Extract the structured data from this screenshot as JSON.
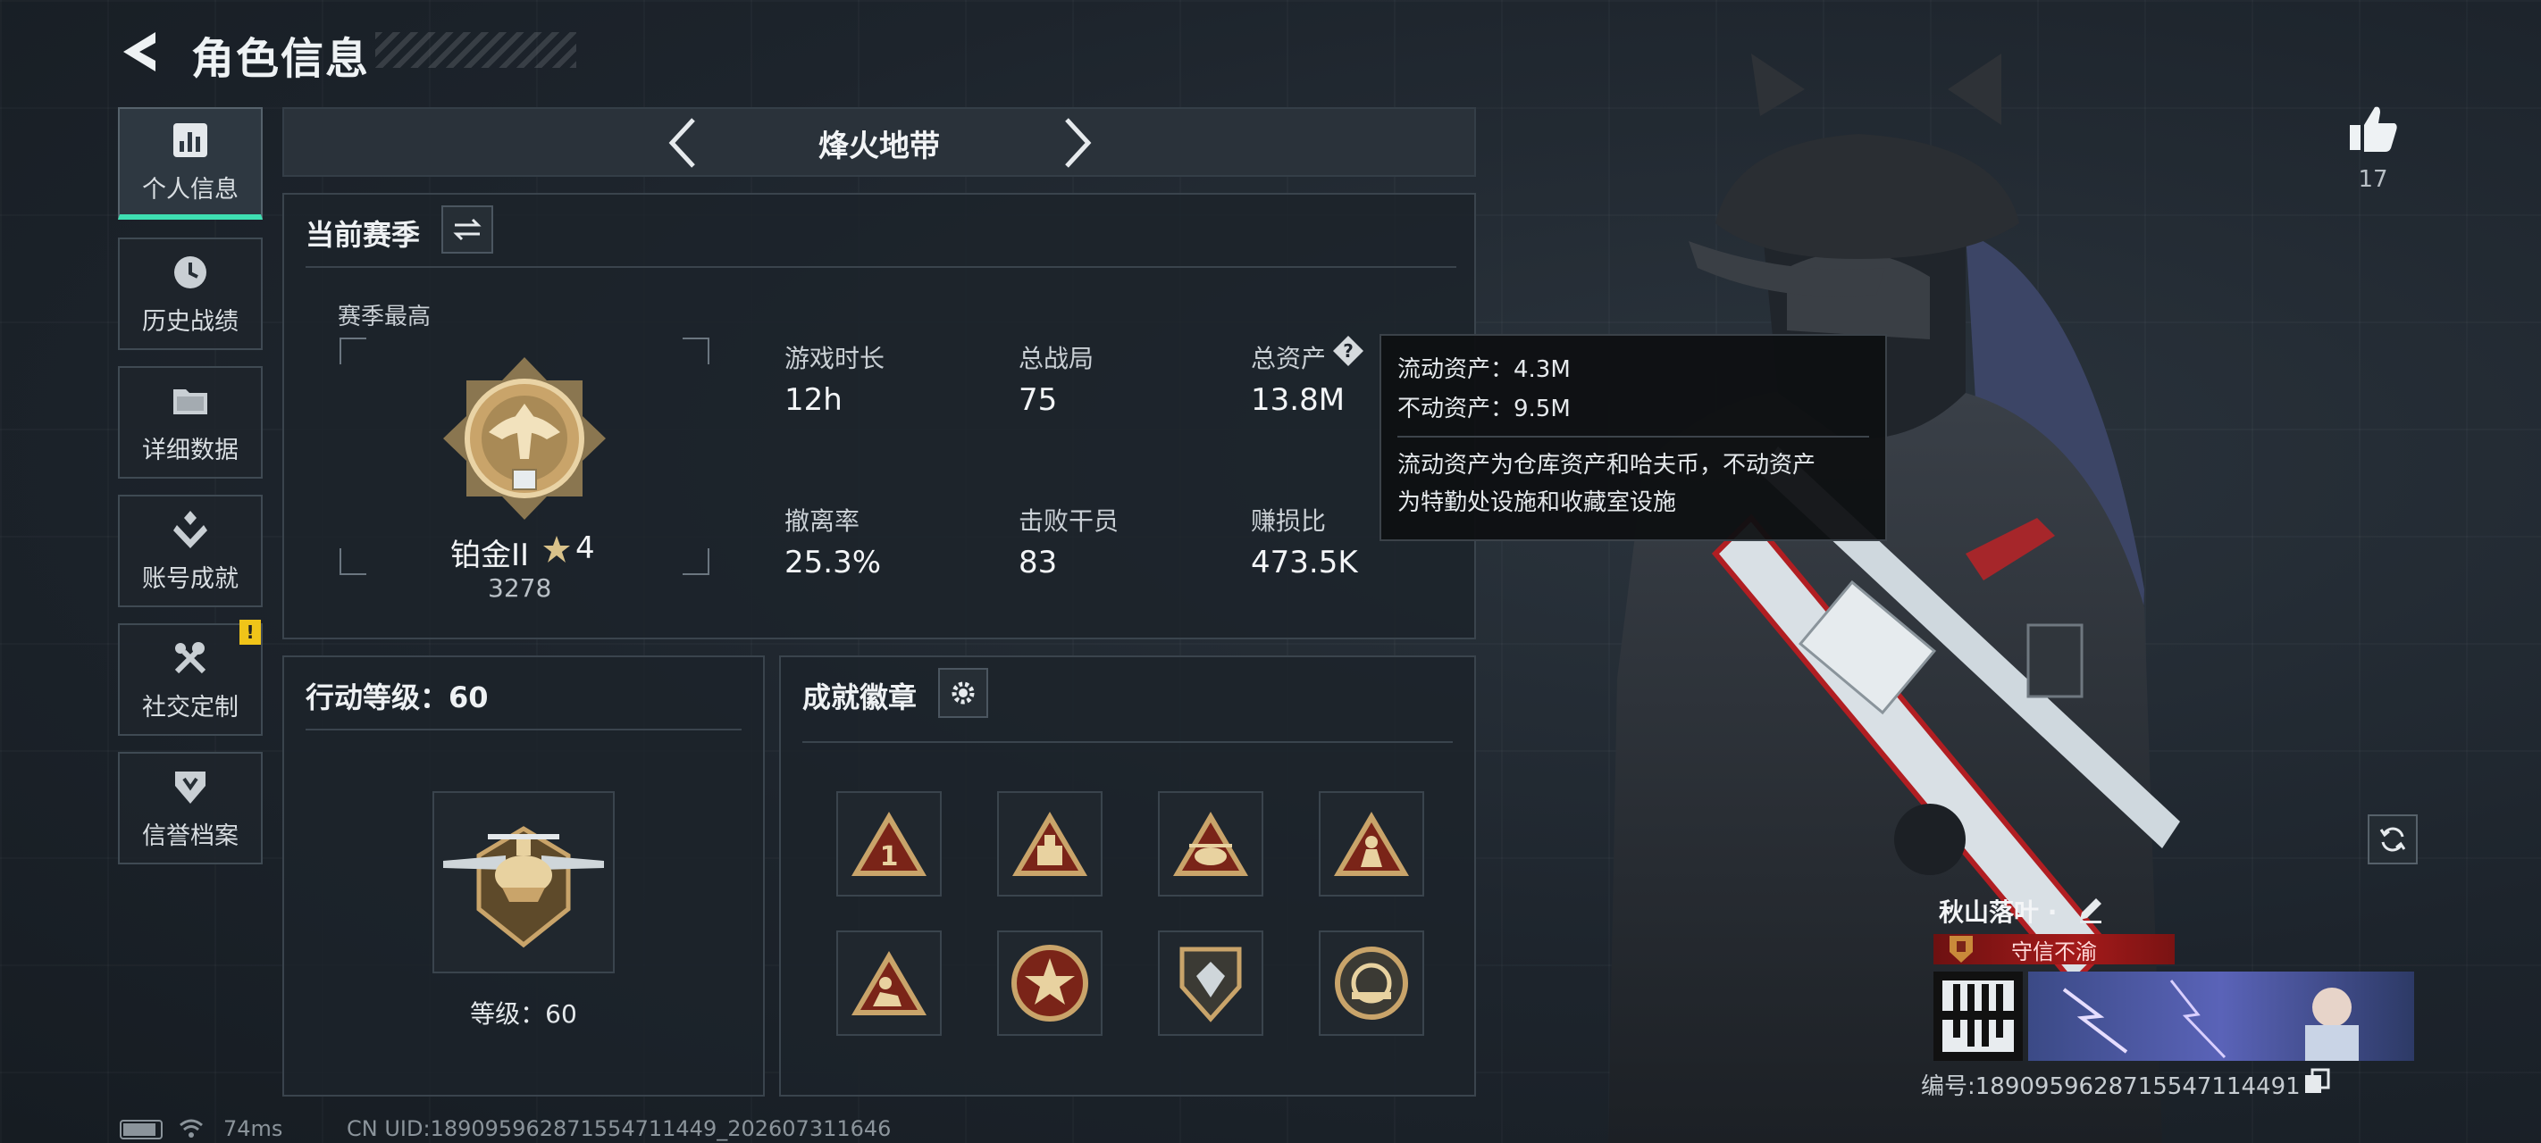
{
  "header": {
    "title": "角色信息"
  },
  "likes": {
    "count": "17"
  },
  "nav": {
    "items": [
      {
        "label": "个人信息",
        "icon": "bar-chart-icon",
        "active": true
      },
      {
        "label": "历史战绩",
        "icon": "clock-icon"
      },
      {
        "label": "详细数据",
        "icon": "folder-icon"
      },
      {
        "label": "账号成就",
        "icon": "achievement-icon"
      },
      {
        "label": "社交定制",
        "icon": "tools-icon",
        "badge": "!"
      },
      {
        "label": "信誉档案",
        "icon": "shield-icon"
      }
    ]
  },
  "mode": {
    "title": "烽火地带"
  },
  "season": {
    "title": "当前赛季",
    "best_label": "赛季最高",
    "rank_name": "铂金II",
    "rank_stars": "4",
    "rank_score": "3278",
    "stats": [
      {
        "label": "游戏时长",
        "value": "12h"
      },
      {
        "label": "总战局",
        "value": "75"
      },
      {
        "label": "总资产",
        "value": "13.8M"
      },
      {
        "label": "撤离率",
        "value": "25.3%"
      },
      {
        "label": "击败干员",
        "value": "83"
      },
      {
        "label": "赚损比",
        "value": "473.5K"
      }
    ]
  },
  "tooltip": {
    "line1": "流动资产：4.3M",
    "line2": "不动资产：9.5M",
    "desc1": "流动资产为仓库资产和哈夫币，不动资产",
    "desc2": "为特勤处设施和收藏室设施"
  },
  "level": {
    "title": "行动等级：60",
    "text": "等级：60"
  },
  "badges": {
    "title": "成就徽章"
  },
  "player": {
    "name": "秋山落叶 ·",
    "title": "守信不渝",
    "uid": "编号:1890959628715547114491"
  },
  "status": {
    "ping": "74ms",
    "cn_uid": "CN UID:18909596287155471144​9_202607311646"
  },
  "colors": {
    "accent": "#3ee0b2",
    "banner": "#a41a1a",
    "badge": "#f0c419"
  }
}
